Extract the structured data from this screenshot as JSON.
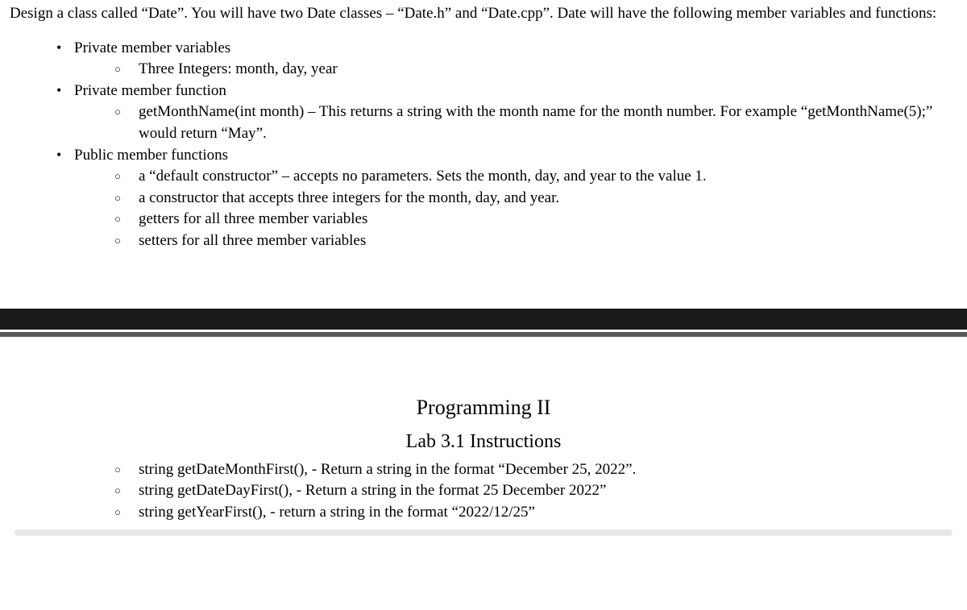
{
  "intro": "Design a class called “Date”.  You will have two Date classes – “Date.h” and “Date.cpp”.  Date will have the following member variables and functions:",
  "bullets": [
    {
      "text": "Private member variables",
      "sub": [
        "Three Integers: month, day, year"
      ]
    },
    {
      "text": "Private member function",
      "sub": [
        "getMonthName(int month) – This returns a string with the month name for the month number. For example “getMonthName(5);” would return “May”."
      ]
    },
    {
      "text": "Public member functions",
      "sub": [
        "a “default constructor” – accepts no parameters. Sets the month, day, and year to the value 1.",
        "a constructor that accepts three integers for the month, day, and year.",
        "getters for all three member variables",
        "setters for all three member variables"
      ]
    }
  ],
  "header": {
    "title": "Programming II",
    "subtitle": "Lab 3.1 Instructions"
  },
  "bottom_sub": [
    "string getDateMonthFirst(), - Return a string in the format “December 25, 2022”.",
    "string getDateDayFirst(),  - Return a string in the format 25 December 2022”",
    "string getYearFirst(), - return a string in the format “2022/12/25”"
  ]
}
